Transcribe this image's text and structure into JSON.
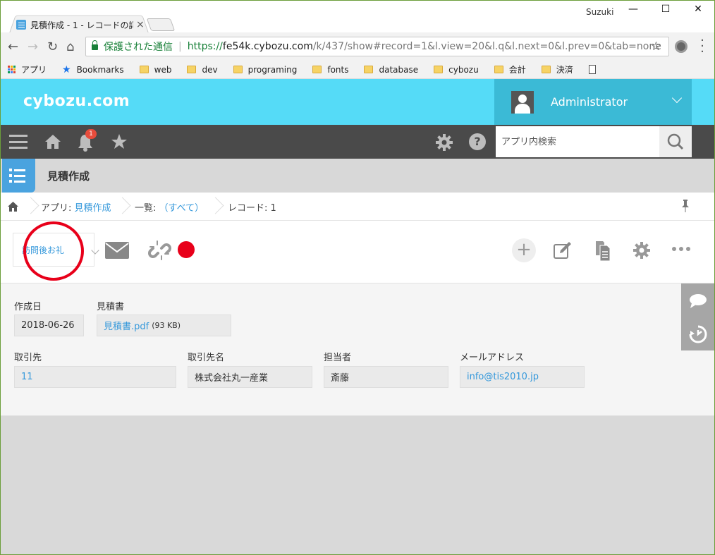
{
  "browser": {
    "tab_title": "見積作成 - 1 - レコードの詳",
    "tab_close": "×",
    "window_user": "Suzuki",
    "controls": {
      "minimize": "—",
      "maximize": "☐",
      "close": "✕"
    },
    "nav": {
      "back": "←",
      "forward": "→",
      "reload": "↻",
      "home": "⌂"
    },
    "secure_label": "保護された通信",
    "url_scheme": "https://",
    "url_host": "fe54k.cybozu.com",
    "url_path": "/k/437/show#record=1&l.view=20&l.q&l.next=0&l.prev=0&tab=none",
    "bookmark_star": "☆",
    "bookmarks": [
      "アプリ",
      "Bookmarks",
      "web",
      "dev",
      "programing",
      "fonts",
      "database",
      "cybozu",
      "会計",
      "決済"
    ],
    "colors": {
      "secure": "#188038",
      "folder": "#f6d365"
    }
  },
  "header": {
    "logo": "cybozu.com",
    "username": "Administrator",
    "notification_count": "1",
    "search_placeholder": "アプリ内検索",
    "help": "?",
    "colors": {
      "brand": "#55dbf7",
      "user_area": "#3bbad6",
      "toolbar": "#4a4a4a"
    }
  },
  "app": {
    "title": "見積作成",
    "breadcrumb": {
      "app_prefix": "アプリ: ",
      "app_name": "見積作成",
      "list_prefix": "一覧: ",
      "list_name": "（すべて）",
      "record": "レコード: 1"
    }
  },
  "actions": {
    "status_label": "訪問後お礼",
    "plus": "+",
    "highlight_color": "#e8001a"
  },
  "record": {
    "fields": [
      {
        "label": "作成日",
        "value": "2018-06-26"
      },
      {
        "label": "見積書",
        "value": "見積書.pdf",
        "size": "(93 KB)"
      },
      {
        "label": "取引先",
        "value": "11"
      },
      {
        "label": "取引先名",
        "value": "株式会社丸一産業"
      },
      {
        "label": "担当者",
        "value": "斎藤"
      },
      {
        "label": "メールアドレス",
        "value": "info@tis2010.jp"
      }
    ]
  }
}
